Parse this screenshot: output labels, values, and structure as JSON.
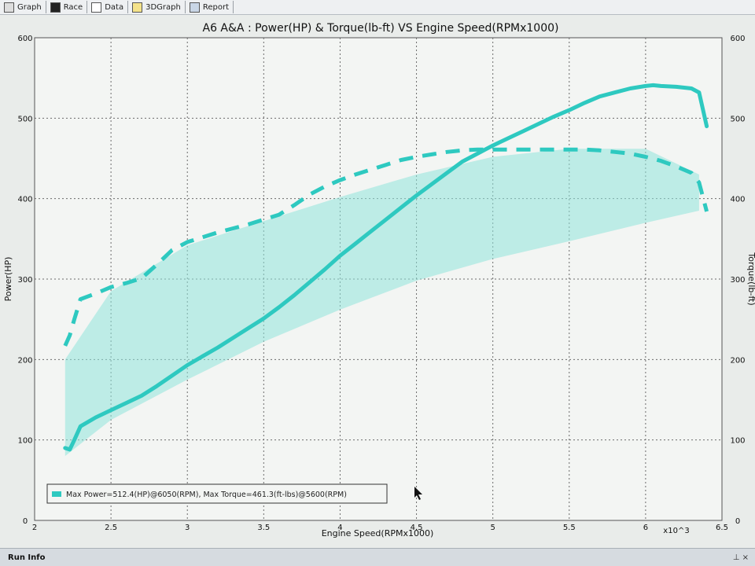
{
  "toolbar": {
    "tabs": [
      {
        "label": "Graph",
        "icon": "graph-icon"
      },
      {
        "label": "Race",
        "icon": "race-flag-icon"
      },
      {
        "label": "Data",
        "icon": "table-icon"
      },
      {
        "label": "3DGraph",
        "icon": "graph3d-icon"
      },
      {
        "label": "Report",
        "icon": "report-icon"
      }
    ]
  },
  "statusbar": {
    "label": "Run Info",
    "pins": "⊥ ×"
  },
  "chart_data": {
    "type": "line",
    "title": "A6 A&A : Power(HP) & Torque(lb-ft) VS Engine Speed(RPMx1000)",
    "xlabel": "Engine Speed(RPMx1000)",
    "ylabel": "Power(HP)",
    "ylabel_right": "Torque(lb-ft)",
    "x_multiplier_label": "x10^3",
    "xlim": [
      2,
      6.5
    ],
    "ylim": [
      0,
      600
    ],
    "ylim_right": [
      0,
      600
    ],
    "x_ticks": [
      2,
      2.5,
      3,
      3.5,
      4,
      4.5,
      5,
      5.5,
      6,
      6.5
    ],
    "x_tick_labels": [
      "2",
      "2.5",
      "3",
      "3.5",
      "4",
      "4.5",
      "5",
      "5.5",
      "6",
      "6.5"
    ],
    "y_ticks": [
      0,
      100,
      200,
      300,
      400,
      500,
      600
    ],
    "y_tick_labels": [
      "0",
      "100",
      "200",
      "300",
      "400",
      "500",
      "600"
    ],
    "grid": true,
    "legend_position": "bottom-left",
    "legend_text": "Max Power=512.4(HP)@6050(RPM), Max Torque=461.3(ft-lbs)@5600(RPM)",
    "colors": {
      "series": "#2ec9c0",
      "band": "#8fe3db",
      "grid": "#6b6b6b",
      "plot_bg": "#f3f5f3"
    },
    "series": [
      {
        "role": "power",
        "style": "solid",
        "x": [
          2.2,
          2.23,
          2.26,
          2.3,
          2.4,
          2.5,
          2.6,
          2.7,
          2.8,
          2.9,
          3.0,
          3.1,
          3.2,
          3.3,
          3.4,
          3.5,
          3.6,
          3.7,
          3.8,
          3.9,
          4.0,
          4.1,
          4.2,
          4.3,
          4.4,
          4.5,
          4.6,
          4.7,
          4.8,
          4.9,
          5.0,
          5.1,
          5.2,
          5.3,
          5.4,
          5.5,
          5.6,
          5.7,
          5.8,
          5.9,
          6.0,
          6.05,
          6.1,
          6.2,
          6.3,
          6.35,
          6.4
        ],
        "values": [
          90,
          88,
          100,
          117,
          128,
          137,
          146,
          155,
          167,
          180,
          193,
          204,
          215,
          227,
          239,
          251,
          265,
          280,
          296,
          312,
          329,
          344,
          359,
          374,
          389,
          404,
          418,
          432,
          446,
          456,
          466,
          475,
          484,
          493,
          502,
          510,
          519,
          527,
          532,
          537,
          540,
          541,
          540,
          539,
          537,
          532,
          490
        ]
      },
      {
        "role": "torque",
        "style": "dashed",
        "x": [
          2.2,
          2.23,
          2.26,
          2.3,
          2.4,
          2.5,
          2.6,
          2.7,
          2.8,
          2.9,
          3.0,
          3.1,
          3.2,
          3.3,
          3.4,
          3.5,
          3.6,
          3.7,
          3.8,
          3.9,
          4.0,
          4.1,
          4.2,
          4.3,
          4.4,
          4.5,
          4.6,
          4.7,
          4.8,
          4.9,
          5.0,
          5.1,
          5.2,
          5.3,
          5.4,
          5.5,
          5.6,
          5.7,
          5.8,
          5.9,
          6.0,
          6.1,
          6.2,
          6.3,
          6.35,
          6.4
        ],
        "values": [
          217,
          230,
          250,
          275,
          282,
          290,
          295,
          301,
          318,
          336,
          346,
          352,
          358,
          363,
          368,
          374,
          380,
          392,
          405,
          415,
          423,
          430,
          436,
          442,
          448,
          452,
          455,
          458,
          460,
          461,
          461,
          461,
          461,
          461,
          461,
          461,
          461,
          460,
          458,
          456,
          452,
          447,
          440,
          432,
          420,
          384
        ]
      }
    ],
    "band": {
      "x": [
        2.2,
        2.5,
        3.0,
        3.5,
        4.0,
        4.5,
        5.0,
        5.5,
        6.0,
        6.35
      ],
      "upper": [
        200,
        285,
        342,
        372,
        402,
        430,
        452,
        462,
        462,
        430
      ],
      "lower": [
        80,
        125,
        175,
        222,
        262,
        298,
        325,
        347,
        370,
        385
      ]
    }
  }
}
